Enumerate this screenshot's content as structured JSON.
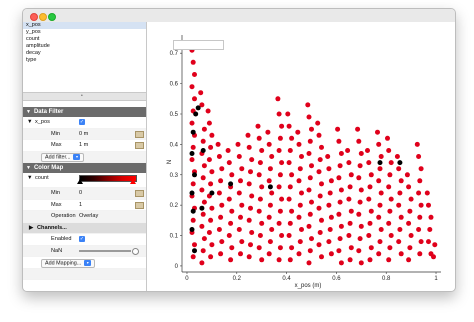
{
  "window": {
    "controls": [
      "close",
      "minimize",
      "zoom"
    ]
  },
  "fields": [
    "x_pos",
    "y_pos",
    "count",
    "amplitude",
    "decay",
    "type"
  ],
  "data_filter": {
    "title": "Data Filter",
    "field": "x_pos",
    "min_label": "Min",
    "min_value": "0 m",
    "max_label": "Max",
    "max_value": "1 m",
    "add_button": "Add filter..."
  },
  "color_map": {
    "title": "Color Map",
    "field": "count",
    "min_label": "Min",
    "min_value": "0",
    "max_label": "Max",
    "max_value": "1",
    "operation_label": "Operation",
    "operation_value": "Overlay",
    "channels_label": "Channels...",
    "enabled_label": "Enabled",
    "nan_label": "NaN",
    "add_button": "Add Mapping...",
    "gradient_colors": [
      "#000000",
      "#ff0000"
    ]
  },
  "plot": {
    "x_label": "x_pos (m)",
    "y_label": "N",
    "x_ticks": [
      "0",
      "0.2",
      "0.4",
      "0.6",
      "0.8",
      "1"
    ],
    "y_ticks": [
      "0",
      "0.1",
      "0.2",
      "0.3",
      "0.4",
      "0.5",
      "0.6",
      "0.7"
    ],
    "xlim": [
      0,
      1
    ],
    "ylim": [
      0,
      0.75
    ],
    "dot_colors": {
      "high": "#e0001b",
      "low": "#000000"
    }
  },
  "chart_data": {
    "type": "scatter",
    "xlabel": "x_pos (m)",
    "ylabel": "N",
    "xlim": [
      -0.02,
      1.02
    ],
    "ylim": [
      -0.02,
      0.76
    ],
    "series": [
      {
        "color": "#e0001b",
        "points": [
          [
            0.02,
            0.71
          ],
          [
            0.025,
            0.67
          ],
          [
            0.03,
            0.63
          ],
          [
            0.02,
            0.59
          ],
          [
            0.03,
            0.55
          ],
          [
            0.025,
            0.51
          ],
          [
            0.02,
            0.47
          ],
          [
            0.03,
            0.43
          ],
          [
            0.025,
            0.39
          ],
          [
            0.02,
            0.35
          ],
          [
            0.03,
            0.31
          ],
          [
            0.025,
            0.27
          ],
          [
            0.02,
            0.23
          ],
          [
            0.03,
            0.19
          ],
          [
            0.025,
            0.15
          ],
          [
            0.02,
            0.11
          ],
          [
            0.03,
            0.07
          ],
          [
            0.025,
            0.03
          ],
          [
            0.055,
            0.57
          ],
          [
            0.06,
            0.53
          ],
          [
            0.07,
            0.45
          ],
          [
            0.065,
            0.41
          ],
          [
            0.06,
            0.37
          ],
          [
            0.07,
            0.33
          ],
          [
            0.065,
            0.29
          ],
          [
            0.06,
            0.25
          ],
          [
            0.07,
            0.21
          ],
          [
            0.065,
            0.17
          ],
          [
            0.06,
            0.13
          ],
          [
            0.07,
            0.09
          ],
          [
            0.065,
            0.05
          ],
          [
            0.06,
            0.01
          ],
          [
            0.085,
            0.51
          ],
          [
            0.09,
            0.47
          ],
          [
            0.1,
            0.43
          ],
          [
            0.095,
            0.39
          ],
          [
            0.09,
            0.35
          ],
          [
            0.1,
            0.31
          ],
          [
            0.095,
            0.27
          ],
          [
            0.09,
            0.23
          ],
          [
            0.1,
            0.19
          ],
          [
            0.095,
            0.15
          ],
          [
            0.09,
            0.11
          ],
          [
            0.1,
            0.07
          ],
          [
            0.095,
            0.03
          ],
          [
            0.125,
            0.4
          ],
          [
            0.13,
            0.36
          ],
          [
            0.14,
            0.32
          ],
          [
            0.135,
            0.28
          ],
          [
            0.13,
            0.24
          ],
          [
            0.14,
            0.2
          ],
          [
            0.135,
            0.16
          ],
          [
            0.13,
            0.12
          ],
          [
            0.14,
            0.08
          ],
          [
            0.135,
            0.04
          ],
          [
            0.165,
            0.38
          ],
          [
            0.17,
            0.34
          ],
          [
            0.18,
            0.3
          ],
          [
            0.175,
            0.26
          ],
          [
            0.17,
            0.22
          ],
          [
            0.18,
            0.18
          ],
          [
            0.175,
            0.14
          ],
          [
            0.17,
            0.1
          ],
          [
            0.18,
            0.06
          ],
          [
            0.175,
            0.02
          ],
          [
            0.205,
            0.4
          ],
          [
            0.21,
            0.36
          ],
          [
            0.22,
            0.32
          ],
          [
            0.215,
            0.28
          ],
          [
            0.21,
            0.24
          ],
          [
            0.22,
            0.2
          ],
          [
            0.215,
            0.16
          ],
          [
            0.21,
            0.12
          ],
          [
            0.22,
            0.08
          ],
          [
            0.215,
            0.04
          ],
          [
            0.245,
            0.43
          ],
          [
            0.25,
            0.39
          ],
          [
            0.26,
            0.35
          ],
          [
            0.255,
            0.31
          ],
          [
            0.25,
            0.27
          ],
          [
            0.26,
            0.23
          ],
          [
            0.255,
            0.19
          ],
          [
            0.25,
            0.15
          ],
          [
            0.26,
            0.11
          ],
          [
            0.255,
            0.07
          ],
          [
            0.25,
            0.03
          ],
          [
            0.285,
            0.46
          ],
          [
            0.29,
            0.42
          ],
          [
            0.3,
            0.38
          ],
          [
            0.295,
            0.34
          ],
          [
            0.29,
            0.3
          ],
          [
            0.3,
            0.26
          ],
          [
            0.295,
            0.22
          ],
          [
            0.29,
            0.18
          ],
          [
            0.3,
            0.14
          ],
          [
            0.295,
            0.1
          ],
          [
            0.29,
            0.06
          ],
          [
            0.3,
            0.02
          ],
          [
            0.325,
            0.44
          ],
          [
            0.33,
            0.4
          ],
          [
            0.34,
            0.36
          ],
          [
            0.335,
            0.32
          ],
          [
            0.33,
            0.28
          ],
          [
            0.34,
            0.24
          ],
          [
            0.335,
            0.2
          ],
          [
            0.33,
            0.16
          ],
          [
            0.34,
            0.12
          ],
          [
            0.335,
            0.08
          ],
          [
            0.33,
            0.04
          ],
          [
            0.365,
            0.55
          ],
          [
            0.37,
            0.5
          ],
          [
            0.38,
            0.46
          ],
          [
            0.375,
            0.42
          ],
          [
            0.37,
            0.38
          ],
          [
            0.38,
            0.34
          ],
          [
            0.375,
            0.3
          ],
          [
            0.37,
            0.26
          ],
          [
            0.38,
            0.22
          ],
          [
            0.375,
            0.18
          ],
          [
            0.37,
            0.14
          ],
          [
            0.38,
            0.1
          ],
          [
            0.375,
            0.06
          ],
          [
            0.37,
            0.02
          ],
          [
            0.405,
            0.5
          ],
          [
            0.41,
            0.46
          ],
          [
            0.42,
            0.42
          ],
          [
            0.415,
            0.38
          ],
          [
            0.41,
            0.34
          ],
          [
            0.42,
            0.3
          ],
          [
            0.415,
            0.26
          ],
          [
            0.41,
            0.22
          ],
          [
            0.42,
            0.18
          ],
          [
            0.415,
            0.14
          ],
          [
            0.41,
            0.1
          ],
          [
            0.42,
            0.06
          ],
          [
            0.415,
            0.02
          ],
          [
            0.445,
            0.44
          ],
          [
            0.45,
            0.4
          ],
          [
            0.46,
            0.36
          ],
          [
            0.455,
            0.32
          ],
          [
            0.45,
            0.28
          ],
          [
            0.46,
            0.24
          ],
          [
            0.455,
            0.2
          ],
          [
            0.45,
            0.16
          ],
          [
            0.46,
            0.12
          ],
          [
            0.455,
            0.08
          ],
          [
            0.45,
            0.04
          ],
          [
            0.485,
            0.53
          ],
          [
            0.49,
            0.49
          ],
          [
            0.5,
            0.45
          ],
          [
            0.495,
            0.41
          ],
          [
            0.49,
            0.37
          ],
          [
            0.5,
            0.33
          ],
          [
            0.495,
            0.29
          ],
          [
            0.49,
            0.25
          ],
          [
            0.5,
            0.21
          ],
          [
            0.495,
            0.17
          ],
          [
            0.49,
            0.13
          ],
          [
            0.5,
            0.09
          ],
          [
            0.495,
            0.05
          ],
          [
            0.49,
            0.01
          ],
          [
            0.525,
            0.47
          ],
          [
            0.53,
            0.43
          ],
          [
            0.54,
            0.39
          ],
          [
            0.535,
            0.35
          ],
          [
            0.53,
            0.31
          ],
          [
            0.54,
            0.27
          ],
          [
            0.535,
            0.23
          ],
          [
            0.53,
            0.19
          ],
          [
            0.54,
            0.15
          ],
          [
            0.535,
            0.11
          ],
          [
            0.53,
            0.07
          ],
          [
            0.54,
            0.03
          ],
          [
            0.565,
            0.36
          ],
          [
            0.57,
            0.32
          ],
          [
            0.58,
            0.28
          ],
          [
            0.575,
            0.24
          ],
          [
            0.57,
            0.2
          ],
          [
            0.58,
            0.16
          ],
          [
            0.575,
            0.12
          ],
          [
            0.57,
            0.08
          ],
          [
            0.58,
            0.04
          ],
          [
            0.605,
            0.45
          ],
          [
            0.61,
            0.41
          ],
          [
            0.62,
            0.37
          ],
          [
            0.615,
            0.33
          ],
          [
            0.61,
            0.29
          ],
          [
            0.62,
            0.25
          ],
          [
            0.615,
            0.21
          ],
          [
            0.61,
            0.17
          ],
          [
            0.62,
            0.13
          ],
          [
            0.615,
            0.09
          ],
          [
            0.61,
            0.05
          ],
          [
            0.62,
            0.01
          ],
          [
            0.645,
            0.38
          ],
          [
            0.65,
            0.34
          ],
          [
            0.66,
            0.3
          ],
          [
            0.655,
            0.26
          ],
          [
            0.65,
            0.22
          ],
          [
            0.66,
            0.18
          ],
          [
            0.655,
            0.14
          ],
          [
            0.65,
            0.1
          ],
          [
            0.66,
            0.06
          ],
          [
            0.655,
            0.02
          ],
          [
            0.685,
            0.45
          ],
          [
            0.69,
            0.41
          ],
          [
            0.7,
            0.37
          ],
          [
            0.695,
            0.33
          ],
          [
            0.69,
            0.29
          ],
          [
            0.7,
            0.25
          ],
          [
            0.695,
            0.21
          ],
          [
            0.69,
            0.17
          ],
          [
            0.7,
            0.13
          ],
          [
            0.695,
            0.09
          ],
          [
            0.69,
            0.05
          ],
          [
            0.7,
            0.01
          ],
          [
            0.725,
            0.38
          ],
          [
            0.73,
            0.34
          ],
          [
            0.74,
            0.3
          ],
          [
            0.735,
            0.26
          ],
          [
            0.73,
            0.22
          ],
          [
            0.74,
            0.18
          ],
          [
            0.735,
            0.14
          ],
          [
            0.73,
            0.1
          ],
          [
            0.74,
            0.06
          ],
          [
            0.735,
            0.02
          ],
          [
            0.765,
            0.44
          ],
          [
            0.77,
            0.4
          ],
          [
            0.78,
            0.36
          ],
          [
            0.775,
            0.32
          ],
          [
            0.77,
            0.28
          ],
          [
            0.78,
            0.24
          ],
          [
            0.775,
            0.2
          ],
          [
            0.77,
            0.16
          ],
          [
            0.78,
            0.12
          ],
          [
            0.775,
            0.08
          ],
          [
            0.77,
            0.04
          ],
          [
            0.805,
            0.42
          ],
          [
            0.81,
            0.38
          ],
          [
            0.82,
            0.34
          ],
          [
            0.815,
            0.3
          ],
          [
            0.81,
            0.26
          ],
          [
            0.82,
            0.22
          ],
          [
            0.815,
            0.18
          ],
          [
            0.81,
            0.14
          ],
          [
            0.82,
            0.1
          ],
          [
            0.815,
            0.06
          ],
          [
            0.81,
            0.02
          ],
          [
            0.845,
            0.36
          ],
          [
            0.85,
            0.32
          ],
          [
            0.86,
            0.28
          ],
          [
            0.855,
            0.24
          ],
          [
            0.85,
            0.2
          ],
          [
            0.86,
            0.16
          ],
          [
            0.855,
            0.12
          ],
          [
            0.85,
            0.08
          ],
          [
            0.86,
            0.04
          ],
          [
            0.885,
            0.3
          ],
          [
            0.89,
            0.26
          ],
          [
            0.9,
            0.22
          ],
          [
            0.895,
            0.18
          ],
          [
            0.89,
            0.14
          ],
          [
            0.9,
            0.1
          ],
          [
            0.895,
            0.06
          ],
          [
            0.89,
            0.02
          ],
          [
            0.925,
            0.4
          ],
          [
            0.93,
            0.36
          ],
          [
            0.94,
            0.32
          ],
          [
            0.935,
            0.28
          ],
          [
            0.93,
            0.24
          ],
          [
            0.94,
            0.2
          ],
          [
            0.935,
            0.16
          ],
          [
            0.93,
            0.12
          ],
          [
            0.94,
            0.08
          ],
          [
            0.935,
            0.04
          ],
          [
            0.965,
            0.24
          ],
          [
            0.97,
            0.2
          ],
          [
            0.98,
            0.16
          ],
          [
            0.975,
            0.12
          ],
          [
            0.97,
            0.08
          ],
          [
            0.98,
            0.04
          ],
          [
            0.995,
            0.07
          ],
          [
            0.99,
            0.03
          ]
        ]
      },
      {
        "color": "#000000",
        "points": [
          [
            0.035,
            0.5
          ],
          [
            0.025,
            0.44
          ],
          [
            0.02,
            0.37
          ],
          [
            0.03,
            0.3
          ],
          [
            0.02,
            0.24
          ],
          [
            0.025,
            0.18
          ],
          [
            0.02,
            0.12
          ],
          [
            0.03,
            0.05
          ],
          [
            0.045,
            0.52
          ],
          [
            0.065,
            0.38
          ],
          [
            0.06,
            0.19
          ],
          [
            0.1,
            0.24
          ],
          [
            0.175,
            0.27
          ],
          [
            0.335,
            0.26
          ],
          [
            0.775,
            0.34
          ],
          [
            0.855,
            0.34
          ]
        ]
      }
    ]
  }
}
